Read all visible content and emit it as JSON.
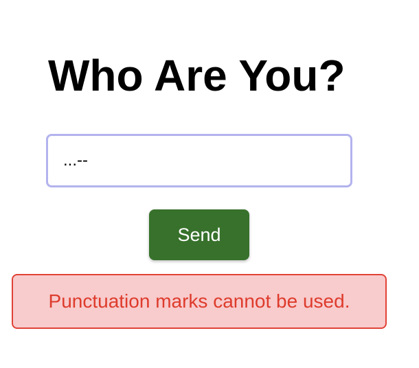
{
  "page": {
    "title": "Who Are You?"
  },
  "form": {
    "name_value": "...--",
    "send_label": "Send"
  },
  "error": {
    "message": "Punctuation marks cannot be used."
  },
  "colors": {
    "input_border": "#b3b3ee",
    "button_bg": "#37712b",
    "button_text": "#ffffff",
    "error_bg": "#f8cbcc",
    "error_border": "#e14236",
    "error_text": "#de3b2c"
  }
}
